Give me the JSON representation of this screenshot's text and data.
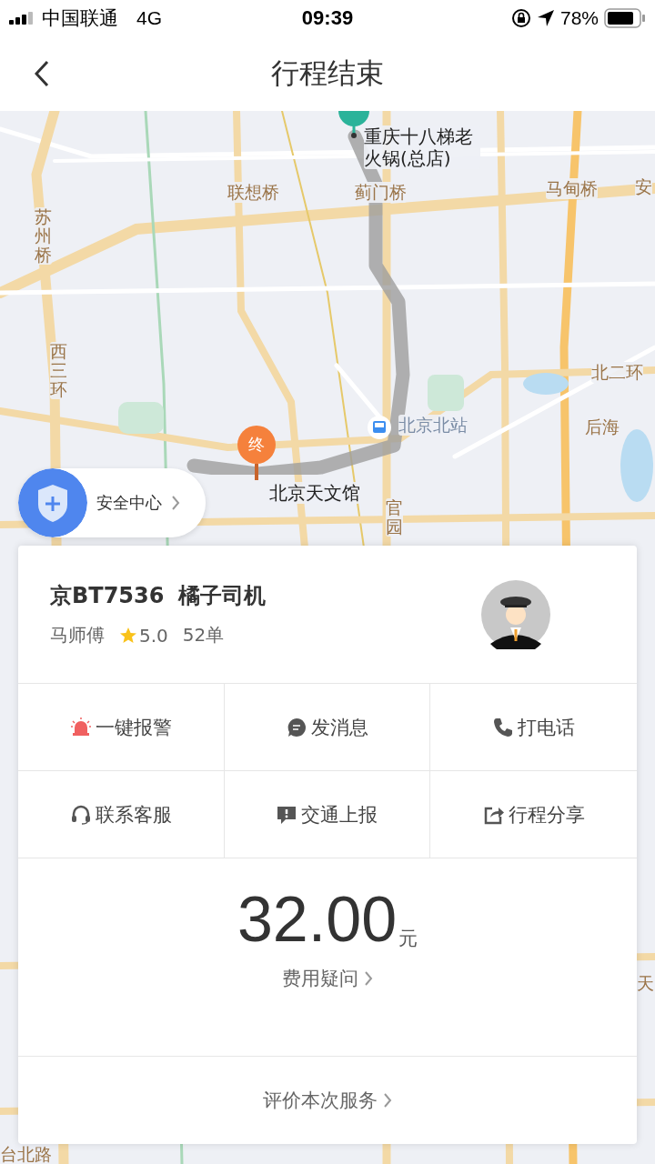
{
  "status_bar": {
    "carrier": "中国联通",
    "network": "4G",
    "time": "09:39",
    "battery": "78%"
  },
  "nav": {
    "title": "行程结束"
  },
  "map": {
    "labels": [
      {
        "text": "重庆十八梯老火锅(总店)",
        "kind": "poi"
      },
      {
        "text": "联想桥",
        "kind": "road"
      },
      {
        "text": "蓟门桥",
        "kind": "road"
      },
      {
        "text": "马甸桥",
        "kind": "road"
      },
      {
        "text": "安",
        "kind": "road"
      },
      {
        "text": "苏州桥",
        "kind": "road_vertical"
      },
      {
        "text": "西三环",
        "kind": "road_vertical"
      },
      {
        "text": "北二环",
        "kind": "road"
      },
      {
        "text": "北京北站",
        "kind": "station"
      },
      {
        "text": "后海",
        "kind": "road"
      },
      {
        "text": "北京天文馆",
        "kind": "poi"
      },
      {
        "text": "官园",
        "kind": "road_vertical"
      },
      {
        "text": "天",
        "kind": "road"
      },
      {
        "text": "台北路",
        "kind": "road"
      }
    ],
    "end_marker": "终"
  },
  "safety": {
    "label": "安全中心"
  },
  "driver": {
    "plate": "京BT7536",
    "company": "橘子司机",
    "name": "马师傅",
    "rating": "5.0",
    "orders": "52单"
  },
  "actions": [
    {
      "label": "一键报警",
      "kind": "alarm"
    },
    {
      "label": "发消息",
      "kind": "message"
    },
    {
      "label": "打电话",
      "kind": "phone"
    },
    {
      "label": "联系客服",
      "kind": "headset"
    },
    {
      "label": "交通上报",
      "kind": "report"
    },
    {
      "label": "行程分享",
      "kind": "share"
    }
  ],
  "fare": {
    "amount": "32.00",
    "unit": "元",
    "link": "费用疑问"
  },
  "review": {
    "label": "评价本次服务"
  }
}
